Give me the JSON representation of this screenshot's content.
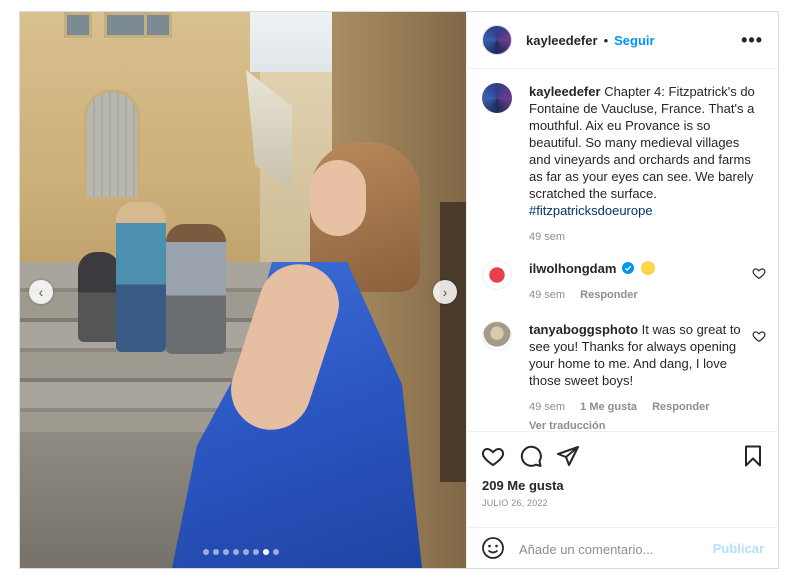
{
  "post": {
    "username": "kayleedefer",
    "separator": "•",
    "follow_label": "Seguir",
    "more_icon": "more-horizontal-icon",
    "more_label": "•••"
  },
  "carousel": {
    "prev_icon": "chevron-left-icon",
    "next_icon": "chevron-right-icon",
    "prev_glyph": "‹",
    "next_glyph": "›",
    "slide_count": 8,
    "active_index": 6
  },
  "caption": {
    "username": "kayleedefer",
    "text": "Chapter 4: Fitzpatrick's do Fontaine de Vaucluse, France. That's a mouthful. Aix eu Provance is so beautiful. So many medieval villages and vineyards and orchards and farms as far as your eyes can see. We barely scratched the surface.",
    "hashtag": "#fitzpatricksdoeurope",
    "time": "49 sem"
  },
  "comments": [
    {
      "username": "ilwolhongdam",
      "text": "",
      "verified": true,
      "emoji": "star-struck-emoji",
      "time": "49 sem",
      "reply_label": "Responder"
    },
    {
      "username": "tanyaboggsphoto",
      "text": "It was so great to see you! Thanks for always opening your home to me. And dang, I love those sweet boys!",
      "time": "49 sem",
      "likes_label": "1 Me gusta",
      "reply_label": "Responder",
      "translate_label": "Ver traducción"
    }
  ],
  "actions": {
    "likes": "209 Me gusta",
    "date": "JULIO 26, 2022"
  },
  "add_comment": {
    "placeholder": "Añade un comentario...",
    "publish_label": "Publicar"
  },
  "colors": {
    "link_blue": "#0095f6",
    "hashtag_blue": "#00376b",
    "muted_gray": "#8e8e8e",
    "publish_disabled": "#b2dffc"
  }
}
